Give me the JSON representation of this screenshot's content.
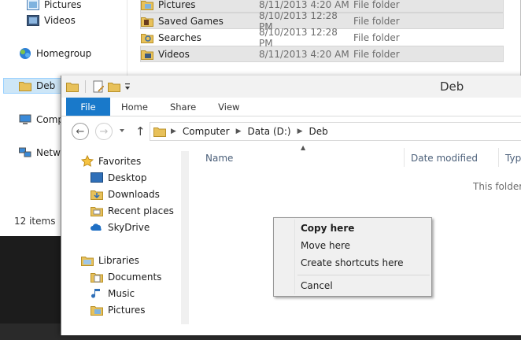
{
  "background_window": {
    "nav": {
      "pictures": "Pictures",
      "videos": "Videos",
      "homegroup": "Homegroup",
      "deb": "Deb",
      "computer": "Comp",
      "network": "Netw"
    },
    "status": "12 items",
    "rows": [
      {
        "name": "Pictures",
        "date": "8/11/2013 4:20 AM",
        "type": "File folder",
        "icon": "pictures-folder-icon"
      },
      {
        "name": "Saved Games",
        "date": "8/10/2013 12:28 PM",
        "type": "File folder",
        "icon": "saved-games-folder-icon"
      },
      {
        "name": "Searches",
        "date": "8/10/2013 12:28 PM",
        "type": "File folder",
        "icon": "searches-folder-icon"
      },
      {
        "name": "Videos",
        "date": "8/11/2013 4:20 AM",
        "type": "File folder",
        "icon": "videos-folder-icon"
      }
    ]
  },
  "window": {
    "title": "Deb",
    "ribbon_tabs": [
      "File",
      "Home",
      "Share",
      "View"
    ],
    "breadcrumb": [
      "Computer",
      "Data (D:)",
      "Deb"
    ],
    "nav_pane": {
      "favorites": "Favorites",
      "desktop": "Desktop",
      "downloads": "Downloads",
      "recent_places": "Recent places",
      "skydrive": "SkyDrive",
      "libraries": "Libraries",
      "documents": "Documents",
      "music": "Music",
      "pictures": "Pictures"
    },
    "columns": {
      "name": "Name",
      "date_modified": "Date modified",
      "type": "Typ"
    },
    "empty_message": "This folder i"
  },
  "context_menu": {
    "copy_here": "Copy here",
    "move_here": "Move here",
    "create_shortcuts": "Create shortcuts here",
    "cancel": "Cancel"
  },
  "colors": {
    "file_tab": "#1979ca",
    "selection": "#cde6f7",
    "folder": "#e8c15a"
  }
}
